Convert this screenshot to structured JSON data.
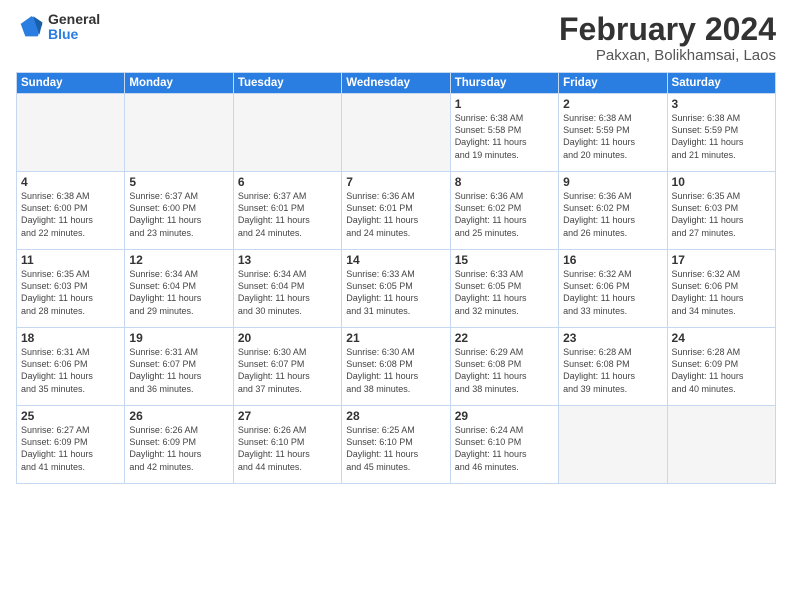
{
  "header": {
    "logo_line1": "General",
    "logo_line2": "Blue",
    "title": "February 2024",
    "subtitle": "Pakxan, Bolikhamsai, Laos"
  },
  "days_of_week": [
    "Sunday",
    "Monday",
    "Tuesday",
    "Wednesday",
    "Thursday",
    "Friday",
    "Saturday"
  ],
  "weeks": [
    [
      {
        "day": "",
        "text": ""
      },
      {
        "day": "",
        "text": ""
      },
      {
        "day": "",
        "text": ""
      },
      {
        "day": "",
        "text": ""
      },
      {
        "day": "1",
        "text": "Sunrise: 6:38 AM\nSunset: 5:58 PM\nDaylight: 11 hours\nand 19 minutes."
      },
      {
        "day": "2",
        "text": "Sunrise: 6:38 AM\nSunset: 5:59 PM\nDaylight: 11 hours\nand 20 minutes."
      },
      {
        "day": "3",
        "text": "Sunrise: 6:38 AM\nSunset: 5:59 PM\nDaylight: 11 hours\nand 21 minutes."
      }
    ],
    [
      {
        "day": "4",
        "text": "Sunrise: 6:38 AM\nSunset: 6:00 PM\nDaylight: 11 hours\nand 22 minutes."
      },
      {
        "day": "5",
        "text": "Sunrise: 6:37 AM\nSunset: 6:00 PM\nDaylight: 11 hours\nand 23 minutes."
      },
      {
        "day": "6",
        "text": "Sunrise: 6:37 AM\nSunset: 6:01 PM\nDaylight: 11 hours\nand 24 minutes."
      },
      {
        "day": "7",
        "text": "Sunrise: 6:36 AM\nSunset: 6:01 PM\nDaylight: 11 hours\nand 24 minutes."
      },
      {
        "day": "8",
        "text": "Sunrise: 6:36 AM\nSunset: 6:02 PM\nDaylight: 11 hours\nand 25 minutes."
      },
      {
        "day": "9",
        "text": "Sunrise: 6:36 AM\nSunset: 6:02 PM\nDaylight: 11 hours\nand 26 minutes."
      },
      {
        "day": "10",
        "text": "Sunrise: 6:35 AM\nSunset: 6:03 PM\nDaylight: 11 hours\nand 27 minutes."
      }
    ],
    [
      {
        "day": "11",
        "text": "Sunrise: 6:35 AM\nSunset: 6:03 PM\nDaylight: 11 hours\nand 28 minutes."
      },
      {
        "day": "12",
        "text": "Sunrise: 6:34 AM\nSunset: 6:04 PM\nDaylight: 11 hours\nand 29 minutes."
      },
      {
        "day": "13",
        "text": "Sunrise: 6:34 AM\nSunset: 6:04 PM\nDaylight: 11 hours\nand 30 minutes."
      },
      {
        "day": "14",
        "text": "Sunrise: 6:33 AM\nSunset: 6:05 PM\nDaylight: 11 hours\nand 31 minutes."
      },
      {
        "day": "15",
        "text": "Sunrise: 6:33 AM\nSunset: 6:05 PM\nDaylight: 11 hours\nand 32 minutes."
      },
      {
        "day": "16",
        "text": "Sunrise: 6:32 AM\nSunset: 6:06 PM\nDaylight: 11 hours\nand 33 minutes."
      },
      {
        "day": "17",
        "text": "Sunrise: 6:32 AM\nSunset: 6:06 PM\nDaylight: 11 hours\nand 34 minutes."
      }
    ],
    [
      {
        "day": "18",
        "text": "Sunrise: 6:31 AM\nSunset: 6:06 PM\nDaylight: 11 hours\nand 35 minutes."
      },
      {
        "day": "19",
        "text": "Sunrise: 6:31 AM\nSunset: 6:07 PM\nDaylight: 11 hours\nand 36 minutes."
      },
      {
        "day": "20",
        "text": "Sunrise: 6:30 AM\nSunset: 6:07 PM\nDaylight: 11 hours\nand 37 minutes."
      },
      {
        "day": "21",
        "text": "Sunrise: 6:30 AM\nSunset: 6:08 PM\nDaylight: 11 hours\nand 38 minutes."
      },
      {
        "day": "22",
        "text": "Sunrise: 6:29 AM\nSunset: 6:08 PM\nDaylight: 11 hours\nand 38 minutes."
      },
      {
        "day": "23",
        "text": "Sunrise: 6:28 AM\nSunset: 6:08 PM\nDaylight: 11 hours\nand 39 minutes."
      },
      {
        "day": "24",
        "text": "Sunrise: 6:28 AM\nSunset: 6:09 PM\nDaylight: 11 hours\nand 40 minutes."
      }
    ],
    [
      {
        "day": "25",
        "text": "Sunrise: 6:27 AM\nSunset: 6:09 PM\nDaylight: 11 hours\nand 41 minutes."
      },
      {
        "day": "26",
        "text": "Sunrise: 6:26 AM\nSunset: 6:09 PM\nDaylight: 11 hours\nand 42 minutes."
      },
      {
        "day": "27",
        "text": "Sunrise: 6:26 AM\nSunset: 6:10 PM\nDaylight: 11 hours\nand 44 minutes."
      },
      {
        "day": "28",
        "text": "Sunrise: 6:25 AM\nSunset: 6:10 PM\nDaylight: 11 hours\nand 45 minutes."
      },
      {
        "day": "29",
        "text": "Sunrise: 6:24 AM\nSunset: 6:10 PM\nDaylight: 11 hours\nand 46 minutes."
      },
      {
        "day": "",
        "text": ""
      },
      {
        "day": "",
        "text": ""
      }
    ]
  ]
}
